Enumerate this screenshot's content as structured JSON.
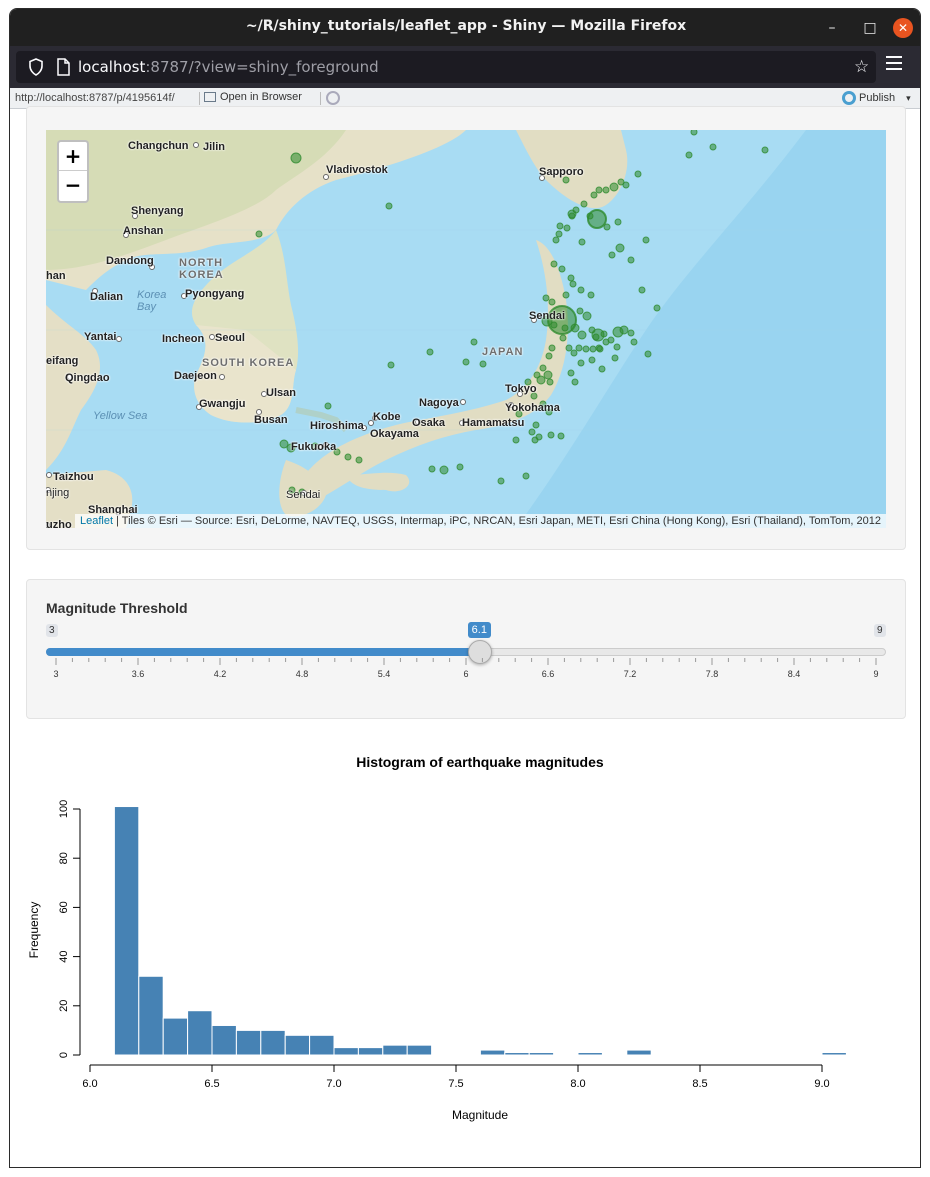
{
  "window": {
    "title": "~/R/shiny_tutorials/leaflet_app - Shiny — Mozilla Firefox",
    "min_glyph": "–",
    "max_glyph": "□",
    "close_glyph": "✕"
  },
  "browser": {
    "url_host": "localhost",
    "url_rest": ":8787/?view=shiny_foreground",
    "icons": [
      "shield-icon",
      "page-icon",
      "bookmark-star-icon",
      "menu-icon"
    ]
  },
  "rstudio_bar": {
    "url": "http://localhost:8787/p/4195614f/",
    "open_in_browser": "Open in Browser",
    "publish": "Publish",
    "publish_caret": "▾"
  },
  "map": {
    "zoom_in": "+",
    "zoom_out": "−",
    "attribution_link": "Leaflet",
    "attribution_text": " | Tiles © Esri — Source: Esri, DeLorme, NAVTEQ, USGS, Intermap, iPC, NRCAN, Esri Japan, METI, Esri China (Hong Kong), Esri (Thailand), TomTom, 2012",
    "marker_color": "#2e8b2e",
    "labels": {
      "changchun": "Changchun",
      "jilin": "Jilin",
      "vladivostok": "Vladivostok",
      "sapporo": "Sapporo",
      "shenyang": "Shenyang",
      "anshan": "Anshan",
      "dandong": "Dandong",
      "north_korea": "NORTH\nKOREA",
      "han": "han",
      "dalian": "Dalian",
      "korea_bay": "Korea\nBay",
      "pyongyang": "Pyongyang",
      "yantai": "Yantai",
      "incheon": "Incheon",
      "seoul": "Seoul",
      "sendai": "Sendai",
      "weifang": "eifang",
      "south_korea": "SOUTH KOREA",
      "japan": "JAPAN",
      "qingdao": "Qingdao",
      "daejeon": "Daejeon",
      "ulsan": "Ulsan",
      "tokyo": "Tokyo",
      "gwangju": "Gwangju",
      "nagoya": "Nagoya",
      "yokohama": "Yokohama",
      "yellow_sea": "Yellow Sea",
      "busan": "Busan",
      "kobe": "Kobe",
      "hiroshima": "Hiroshima",
      "osaka": "Osaka",
      "hamamatsu": "Hamamatsu",
      "okayama": "Okayama",
      "fukuoka": "Fukuoka",
      "taizhou": "Taizhou",
      "jing": "njing",
      "sendai_kyushu": "Sendai",
      "shanghai": "Shanghai",
      "uzhou": "uzho"
    }
  },
  "slider": {
    "label": "Magnitude Threshold",
    "min": 3,
    "max": 9,
    "value": 6.1,
    "value_label": "6.1",
    "min_label": "3",
    "max_label": "9",
    "tick_labels": [
      "3",
      "3.6",
      "4.2",
      "4.8",
      "5.4",
      "6",
      "6.6",
      "7.2",
      "7.8",
      "8.4",
      "9"
    ]
  },
  "chart_data": {
    "type": "bar",
    "title": "Histogram of earthquake magnitudes",
    "xlabel": "Magnitude",
    "ylabel": "Frequency",
    "xlim": [
      6.0,
      9.1
    ],
    "ylim": [
      0,
      100
    ],
    "x_ticks": [
      "6.0",
      "6.5",
      "7.0",
      "7.5",
      "8.0",
      "8.5",
      "9.0"
    ],
    "y_ticks": [
      "0",
      "20",
      "40",
      "60",
      "80",
      "100"
    ],
    "bar_color": "#4682b4",
    "bins": [
      {
        "start": 6.1,
        "end": 6.2,
        "count": 101
      },
      {
        "start": 6.2,
        "end": 6.3,
        "count": 32
      },
      {
        "start": 6.3,
        "end": 6.4,
        "count": 15
      },
      {
        "start": 6.4,
        "end": 6.5,
        "count": 18
      },
      {
        "start": 6.5,
        "end": 6.6,
        "count": 12
      },
      {
        "start": 6.6,
        "end": 6.7,
        "count": 10
      },
      {
        "start": 6.7,
        "end": 6.8,
        "count": 10
      },
      {
        "start": 6.8,
        "end": 6.9,
        "count": 8
      },
      {
        "start": 6.9,
        "end": 7.0,
        "count": 8
      },
      {
        "start": 7.0,
        "end": 7.1,
        "count": 3
      },
      {
        "start": 7.1,
        "end": 7.2,
        "count": 3
      },
      {
        "start": 7.2,
        "end": 7.3,
        "count": 4
      },
      {
        "start": 7.3,
        "end": 7.4,
        "count": 4
      },
      {
        "start": 7.4,
        "end": 7.5,
        "count": 0
      },
      {
        "start": 7.5,
        "end": 7.6,
        "count": 0
      },
      {
        "start": 7.6,
        "end": 7.7,
        "count": 2
      },
      {
        "start": 7.7,
        "end": 7.8,
        "count": 1
      },
      {
        "start": 7.8,
        "end": 7.9,
        "count": 1
      },
      {
        "start": 7.9,
        "end": 8.0,
        "count": 0
      },
      {
        "start": 8.0,
        "end": 8.1,
        "count": 1
      },
      {
        "start": 8.1,
        "end": 8.2,
        "count": 0
      },
      {
        "start": 8.2,
        "end": 8.3,
        "count": 2
      },
      {
        "start": 9.0,
        "end": 9.1,
        "count": 1
      }
    ]
  }
}
